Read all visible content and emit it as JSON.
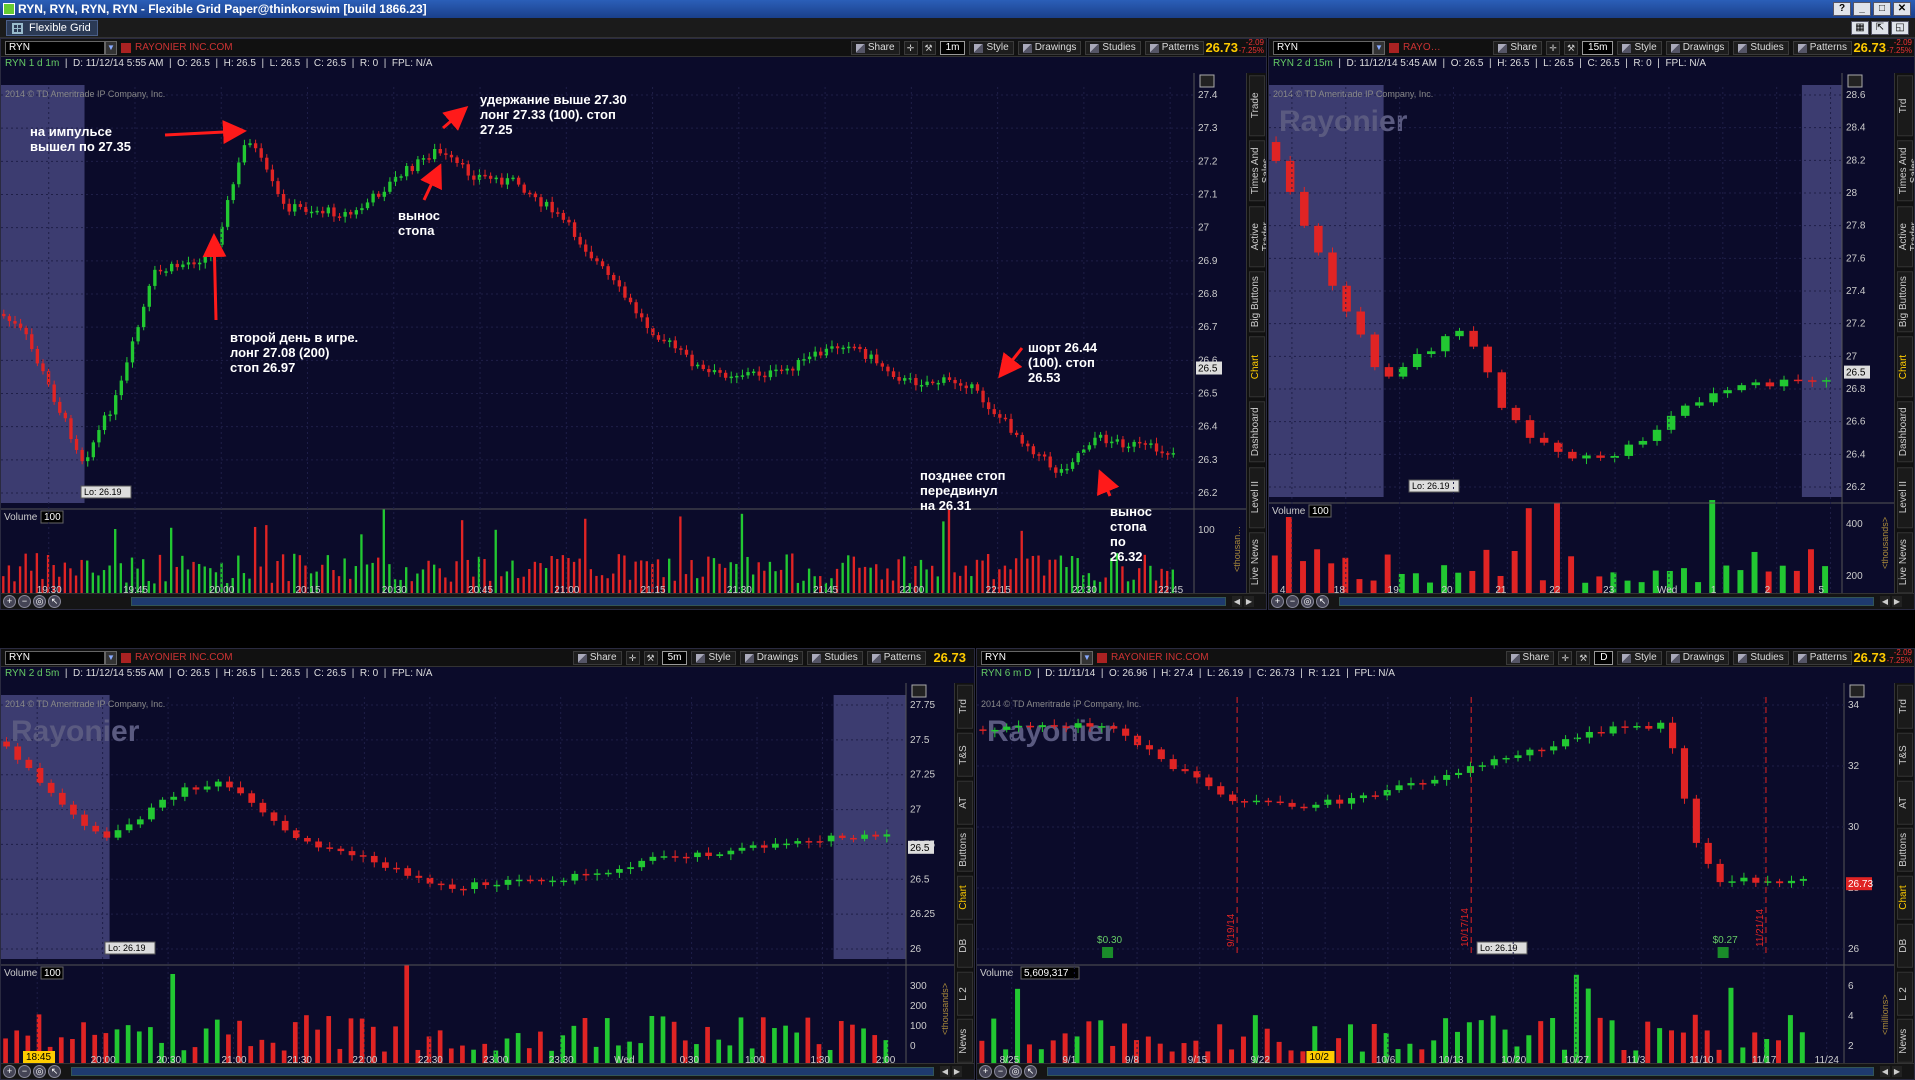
{
  "window": {
    "title": "RYN, RYN, RYN, RYN - Flexible Grid Paper@thinkorswim [build 1866.23]",
    "tab": "Flexible Grid"
  },
  "common": {
    "share": "Share",
    "style": "Style",
    "drawings": "Drawings",
    "studies": "Studies",
    "patterns": "Patterns",
    "company": "RAYONIER INC.COM",
    "company_short": "RAYO…",
    "last": "26.73",
    "chg1": "-2.09",
    "chg2": "-7.25%",
    "copyright": "2014 © TD Ameritrade IP Company, Inc.",
    "watermark": "Rayonier",
    "volume": "Volume",
    "lo": "Lo: 26.19",
    "cur_tag": "26.5"
  },
  "colors": {
    "up": "#22c832",
    "down": "#e02424",
    "bg": "#0b0b2a",
    "grid": "#2a2a50",
    "accent": "#ffcc00"
  },
  "panels": [
    {
      "id": "p1",
      "symbol": "RYN",
      "agg": "1m",
      "info": {
        "sym": "RYN 1 d 1m",
        "d": "D: 11/12/14 5:55 AM",
        "o": "O: 26.5",
        "h": "H: 26.5",
        "l": "L: 26.5",
        "c": "C: 26.5",
        "r": "R: 0",
        "fpl": "FPL: N/A"
      },
      "yticks": [
        "27.4",
        "27.3",
        "27.2",
        "27.1",
        "27",
        "26.9",
        "26.8",
        "26.7",
        "26.6",
        "26.5",
        "26.4",
        "26.3",
        "26.2"
      ],
      "xticks": [
        "19:30",
        "19:45",
        "20:00",
        "20:15",
        "20:30",
        "20:45",
        "21:00",
        "21:15",
        "21:30",
        "21:45",
        "22:00",
        "22:15",
        "22:30",
        "22:45"
      ],
      "vol_scale": "100",
      "vol_tick": "100",
      "vol_unit": "<thousan…",
      "side": [
        "Trade",
        "Times And Sales",
        "Active Trader",
        "Big Buttons",
        "Chart",
        "Dashboard",
        "Level II",
        "Live News"
      ]
    },
    {
      "id": "p2",
      "symbol": "RYN",
      "agg": "15m",
      "info": {
        "sym": "RYN 2 d 15m",
        "d": "D: 11/12/14 5:45 AM",
        "o": "O: 26.5",
        "h": "H: 26.5",
        "l": "L: 26.5",
        "c": "C: 26.5",
        "r": "R: 0",
        "fpl": "FPL: N/A"
      },
      "yticks": [
        "28.6",
        "28.4",
        "28.2",
        "28",
        "27.8",
        "27.6",
        "27.4",
        "27.2",
        "27",
        "26.8",
        "26.6",
        "26.4",
        "26.2"
      ],
      "xticks": [
        "4",
        "18",
        "19",
        "20",
        "21",
        "22",
        "23",
        "Wed",
        "1",
        "2",
        "5"
      ],
      "vol_scale": "100",
      "vol_ticks": [
        "400",
        "200"
      ],
      "vol_unit": "<thousands>",
      "side": [
        "Trd",
        "Times And Sales",
        "Active Trader",
        "Big Buttons",
        "Chart",
        "Dashboard",
        "Level II",
        "Live News"
      ]
    },
    {
      "id": "p3",
      "symbol": "RYN",
      "agg": "5m",
      "info": {
        "sym": "RYN 2 d 5m",
        "d": "D: 11/12/14 5:55 AM",
        "o": "O: 26.5",
        "h": "H: 26.5",
        "l": "L: 26.5",
        "c": "C: 26.5",
        "r": "R: 0",
        "fpl": "FPL: N/A"
      },
      "yticks": [
        "27.75",
        "27.5",
        "27.25",
        "27",
        "26.75",
        "26.5",
        "26.25",
        "26"
      ],
      "xticks": [
        "19:30",
        "20:00",
        "20:30",
        "21:00",
        "21:30",
        "22:00",
        "22:30",
        "23:00",
        "23:30",
        "Wed",
        "0:30",
        "1:00",
        "1:30",
        "2:00"
      ],
      "time_badge": "18:45",
      "vol_scale": "100",
      "vol_ticks": [
        "300",
        "200",
        "100",
        "0"
      ],
      "vol_unit": "<thousands>",
      "side": [
        "Trd",
        "T&S",
        "AT",
        "Buttons",
        "Chart",
        "DB",
        "L 2",
        "News"
      ]
    },
    {
      "id": "p4",
      "symbol": "RYN",
      "agg": "D",
      "info": {
        "sym": "RYN 6 m D",
        "d": "D: 11/11/14",
        "o": "O: 26.96",
        "h": "H: 27.4",
        "l": "L: 26.19",
        "c": "C: 26.73",
        "r": "R: 1.21",
        "fpl": "FPL: N/A"
      },
      "yticks": [
        "34",
        "32",
        "30",
        "28",
        "26"
      ],
      "xticks": [
        "8/25",
        "9/1",
        "9/8",
        "9/15",
        "9/22",
        "9/29",
        "10/6",
        "10/13",
        "10/20",
        "10/27",
        "11/3",
        "11/10",
        "11/17",
        "11/24"
      ],
      "date_badge": "10/2",
      "price_tag": "26.73",
      "events": [
        "9/19/14",
        "10/17/14",
        "11/21/14"
      ],
      "div1": "$0.30",
      "div2": "$0.27",
      "vol_scale": "5,609,317",
      "vol_ticks": [
        "6",
        "4",
        "2"
      ],
      "vol_unit": "<millions>",
      "side": [
        "Trd",
        "T&S",
        "AT",
        "Buttons",
        "Chart",
        "DB",
        "L 2",
        "News"
      ]
    }
  ],
  "annotations": {
    "a1": "на импульсе\nвышел по 27.35",
    "a2": "удержание выше 27.30\nлонг 27.33 (100). стоп\n27.25",
    "a3": "вынос\nстопа",
    "a4": "второй день в игре.\nлонг 27.08 (200)\nстоп 26.97",
    "a5": "шорт 26.44\n(100). стоп\n26.53",
    "a6": "позднее стоп\nпередвинул\nна 26.31",
    "a7": "вынос\nстопа\nпо\n26.32"
  }
}
